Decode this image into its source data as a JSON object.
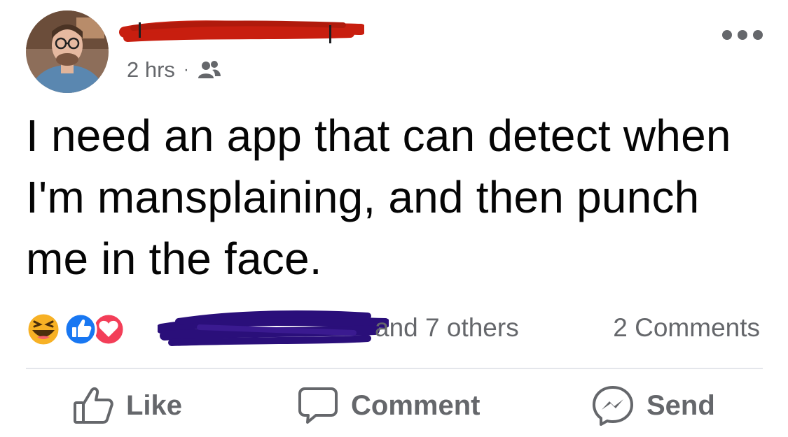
{
  "post": {
    "timestamp": "2 hrs",
    "separator": "·",
    "audience_icon": "friends-icon",
    "more_icon": "more-horizontal-icon",
    "text": "I need an app that can detect when I'm mansplaining, and then punch me in the face.",
    "reactions": {
      "icons": [
        "haha-reaction-icon",
        "like-reaction-icon",
        "love-reaction-icon"
      ],
      "others_text": "and 7 others",
      "comments_count": "2 Comments"
    },
    "actions": {
      "like_label": "Like",
      "comment_label": "Comment",
      "send_label": "Send"
    }
  },
  "colors": {
    "meta_gray": "#65676b",
    "text_black": "#050505",
    "like_blue": "#1877f2",
    "love_red": "#f33e58",
    "haha_yellow": "#f7b125",
    "redaction_red": "#c81e0f",
    "redaction_purple": "#2a0f7a"
  }
}
